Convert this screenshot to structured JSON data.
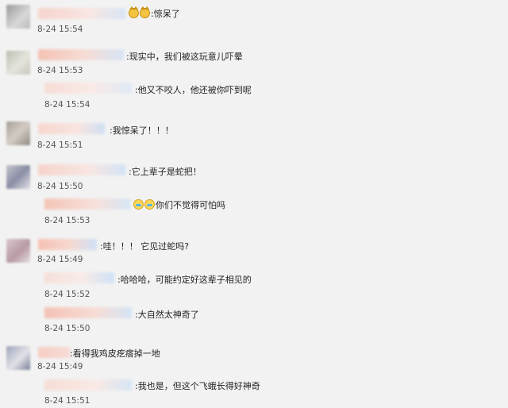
{
  "comments": [
    {
      "text": ":惊呆了",
      "emojis": [
        "cat-emoji",
        "cat-emoji"
      ],
      "time": "8-24 15:54"
    },
    {
      "text": ":现实中，我们被这玩意儿吓晕",
      "time": "8-24 15:53",
      "reply": {
        "text": ":他又不咬人，他还被你吓到呢",
        "time": "8-24 15:54"
      }
    },
    {
      "text": ":我惊呆了！！！",
      "time": "8-24 15:51"
    },
    {
      "text": ":它上辈子是蛇把！",
      "time": "8-24 15:50",
      "reply": {
        "text": "你们不觉得可怕吗",
        "emojis": [
          "laughing-emoji",
          "laughing-emoji"
        ],
        "time": "8-24 15:53"
      }
    },
    {
      "text": ":哇！！！ 它见过蛇吗?",
      "time": "8-24 15:49",
      "replies": [
        {
          "text": ":哈哈哈，可能约定好这辈子相见的",
          "time": "8-24 15:52"
        },
        {
          "text": ":大自然太神奇了",
          "time": "8-24 15:50"
        }
      ]
    },
    {
      "text": ":看得我鸡皮疙瘩掉一地",
      "time": "8-24 15:49",
      "reply": {
        "text": ":我也是，但这个飞蛾长得好神奇",
        "time": "8-24 15:51"
      }
    }
  ]
}
